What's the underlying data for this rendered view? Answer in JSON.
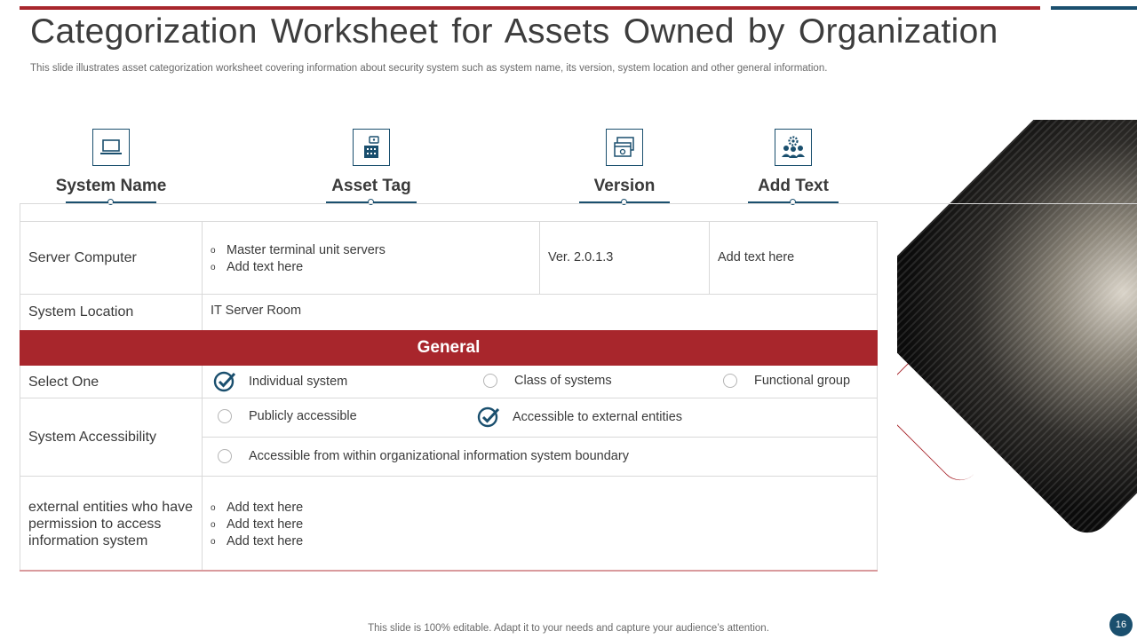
{
  "slide": {
    "title": "Categorization Worksheet for Assets Owned by Organization",
    "subtitle": "This slide illustrates asset categorization worksheet covering information about security system such as system name, its version, system location and other general information.",
    "footer": "This slide is 100% editable. Adapt it to your needs and capture your audience’s attention.",
    "page_number": "16"
  },
  "columns": [
    {
      "label": "System Name",
      "icon": "laptop-icon"
    },
    {
      "label": "Asset Tag",
      "icon": "building-tag-icon"
    },
    {
      "label": "Version",
      "icon": "browser-windows-icon"
    },
    {
      "label": "Add Text",
      "icon": "team-gear-icon"
    }
  ],
  "rows": {
    "server": {
      "label": "Server Computer",
      "bullets": [
        "Master terminal unit servers",
        "Add text here"
      ],
      "version": "Ver. 2.0.1.3",
      "add_text": "Add text here"
    },
    "location": {
      "label": "System Location",
      "value": "IT Server Room"
    },
    "general_header": "General",
    "select_one": {
      "label": "Select One",
      "options": [
        {
          "text": "Individual system",
          "checked": true
        },
        {
          "text": "Class of systems",
          "checked": false
        },
        {
          "text": "Functional group",
          "checked": false
        }
      ]
    },
    "accessibility": {
      "label": "System Accessibility",
      "options": [
        {
          "text": "Publicly accessible",
          "checked": false
        },
        {
          "text": "Accessible to external entities",
          "checked": true
        },
        {
          "text": "Accessible from within organizational information system boundary",
          "checked": false
        }
      ]
    },
    "external": {
      "label": "external entities who have permission to access information system",
      "bullets": [
        "Add text here",
        "Add text here",
        "Add text here"
      ]
    }
  },
  "colors": {
    "accent_red": "#a8262c",
    "accent_blue": "#1a4f6e"
  }
}
